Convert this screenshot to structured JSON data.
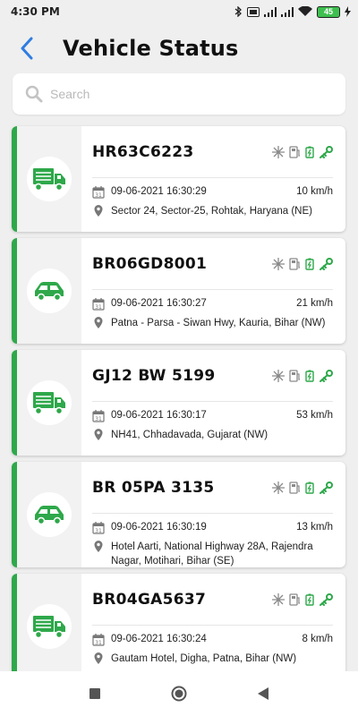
{
  "status_bar": {
    "time": "4:30 PM",
    "battery": "45"
  },
  "header": {
    "title": "Vehicle Status"
  },
  "search": {
    "placeholder": "Search"
  },
  "vehicles": [
    {
      "plate": "HR63C6223",
      "type": "truck",
      "datetime": "09-06-2021 16:30:29",
      "speed": "10 km/h",
      "location": "Sector 24, Sector-25, Rohtak, Haryana (NE)"
    },
    {
      "plate": "BR06GD8001",
      "type": "car",
      "datetime": "09-06-2021 16:30:27",
      "speed": "21 km/h",
      "location": "Patna - Parsa - Siwan Hwy, Kauria, Bihar (NW)"
    },
    {
      "plate": "GJ12 BW 5199",
      "type": "truck",
      "datetime": "09-06-2021 16:30:17",
      "speed": "53 km/h",
      "location": "NH41, Chhadavada, Gujarat (NW)"
    },
    {
      "plate": "BR 05PA 3135",
      "type": "car",
      "datetime": "09-06-2021 16:30:19",
      "speed": "13 km/h",
      "location": "Hotel Aarti, National Highway 28A, Rajendra Nagar, Motihari, Bihar (SE)"
    },
    {
      "plate": "BR04GA5637",
      "type": "truck",
      "datetime": "09-06-2021 16:30:24",
      "speed": "8 km/h",
      "location": "Gautam Hotel, Digha, Patna, Bihar (NW)"
    }
  ],
  "indicator_icons": [
    "snowflake-icon",
    "fuel-icon",
    "battery-icon",
    "key-icon"
  ],
  "colors": {
    "accent": "#2ea84a",
    "back": "#2f7de1",
    "muted_icon": "#8a8a8a"
  }
}
